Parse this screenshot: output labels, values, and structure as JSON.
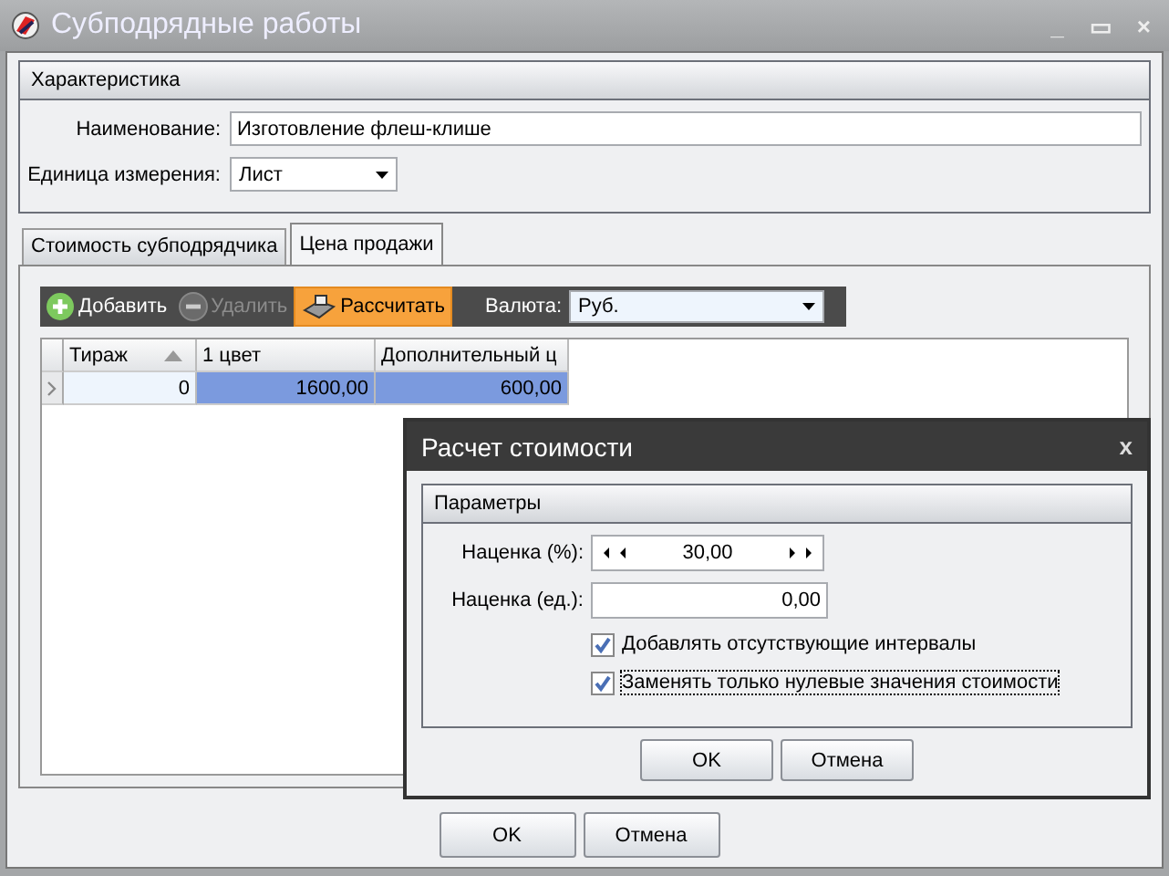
{
  "window": {
    "title": "Субподрядные работы",
    "controls": [
      "_",
      "▭",
      "×"
    ]
  },
  "characteristics": {
    "title": "Характеристика",
    "name_label": "Наименование:",
    "name_value": "Изготовление флеш-клише",
    "unit_label": "Единица измерения:",
    "unit_value": "Лист"
  },
  "tabs": [
    {
      "label": "Стоимость субподрядчика",
      "selected": false
    },
    {
      "label": "Цена продажи",
      "selected": true
    }
  ],
  "toolbar": {
    "buttons": [
      {
        "label": "Добавить",
        "kind": "add",
        "disabled": false,
        "highlighted": false
      },
      {
        "label": "Удалить",
        "kind": "remove",
        "disabled": true,
        "highlighted": false
      },
      {
        "label": "Рассчитать",
        "kind": "calc",
        "disabled": false,
        "highlighted": true
      }
    ],
    "currency_label": "Валюта:",
    "currency_value": "Руб."
  },
  "table": {
    "columns": [
      {
        "label": "Тираж",
        "sorted": true
      },
      {
        "label": "1 цвет",
        "sorted": false
      },
      {
        "label": "Дополнительный ц",
        "sorted": false
      }
    ],
    "rows": [
      {
        "cells": [
          "0",
          "1600,00",
          "600,00"
        ],
        "current": true
      }
    ]
  },
  "buttons": [
    "OK",
    "Отмена"
  ],
  "dialog": {
    "title": "Расчет стоимости",
    "close": "x",
    "group": "Параметры",
    "markup_pct_label": "Наценка (%):",
    "markup_pct_value": "30,00",
    "markup_unit_label": "Наценка (ед.):",
    "markup_unit_value": "0,00",
    "options": [
      {
        "label": "Добавлять отсутствующие интервалы",
        "checked": true,
        "focused": false
      },
      {
        "label": "Заменять только нулевые значения стоимости",
        "checked": true,
        "focused": true
      }
    ],
    "buttons": [
      "OK",
      "Отмена"
    ]
  }
}
